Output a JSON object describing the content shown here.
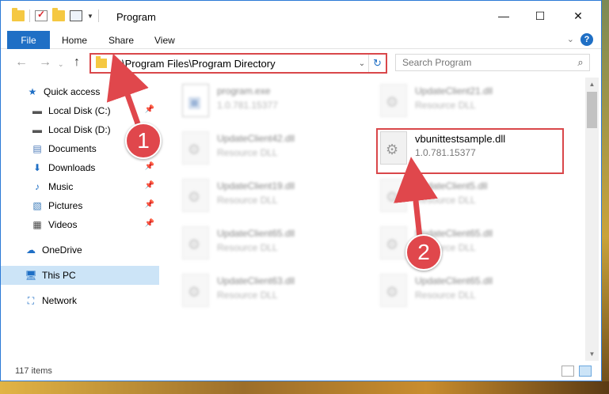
{
  "titlebar": {
    "title": "Program"
  },
  "ribbon": {
    "file": "File",
    "home": "Home",
    "share": "Share",
    "view": "View",
    "help": "?"
  },
  "address": {
    "path": "C:\\Program Files\\Program Directory"
  },
  "search": {
    "placeholder": "Search Program"
  },
  "sidebar": {
    "items": [
      {
        "label": "Quick access",
        "icon": "star-icon"
      },
      {
        "label": "Local Disk (C:)",
        "icon": "drive-icon"
      },
      {
        "label": "Local Disk (D:)",
        "icon": "drive-icon"
      },
      {
        "label": "Documents",
        "icon": "documents-icon"
      },
      {
        "label": "Downloads",
        "icon": "download-icon"
      },
      {
        "label": "Music",
        "icon": "music-icon"
      },
      {
        "label": "Pictures",
        "icon": "pictures-icon"
      },
      {
        "label": "Videos",
        "icon": "videos-icon"
      },
      {
        "label": "OneDrive",
        "icon": "cloud-icon"
      },
      {
        "label": "This PC",
        "icon": "computer-icon"
      },
      {
        "label": "Network",
        "icon": "network-icon"
      }
    ]
  },
  "files": [
    {
      "name": "program.exe",
      "meta": "1.0.781.15377"
    },
    {
      "name": "UpdateClient21.dll",
      "meta": "Resource DLL"
    },
    {
      "name": "UpdateClient42.dll",
      "meta": "Resource DLL"
    },
    {
      "name": "vbunittestsample.dll",
      "meta": "1.0.781.15377"
    },
    {
      "name": "UpdateClient19.dll",
      "meta": "Resource DLL"
    },
    {
      "name": "UpdateClient5.dll",
      "meta": "Resource DLL"
    },
    {
      "name": "UpdateClient65.dll",
      "meta": "Resource DLL"
    },
    {
      "name": "UpdateClient65.dll",
      "meta": "Resource DLL"
    },
    {
      "name": "UpdateClient63.dll",
      "meta": "Resource DLL"
    },
    {
      "name": "UpdateClient65.dll",
      "meta": "Resource DLL"
    }
  ],
  "status": {
    "count": "117 items"
  },
  "callouts": {
    "one": "1",
    "two": "2"
  },
  "colors": {
    "accent": "#1f6fc5",
    "highlight": "#d9474a",
    "selected": "#cce4f7"
  }
}
